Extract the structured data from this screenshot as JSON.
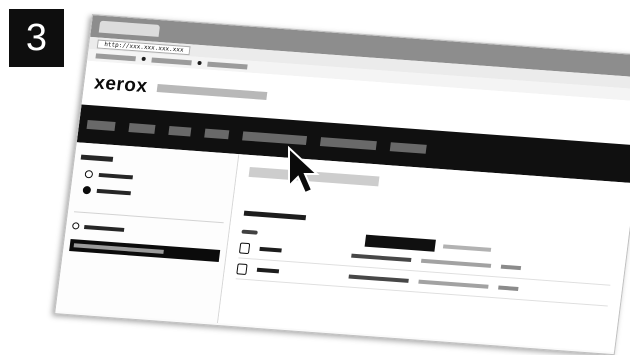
{
  "step": {
    "number": "3"
  },
  "browser": {
    "url": "http://xxx.xxx.xxx.xxx"
  },
  "brand": {
    "logo": "xerox"
  },
  "colors": {
    "nav_bar": "#151515",
    "badge": "#0e0e0e"
  },
  "icons": {
    "cursor": "arrow-cursor-icon",
    "radio": "radio-icon",
    "printer": "printer-icon"
  }
}
